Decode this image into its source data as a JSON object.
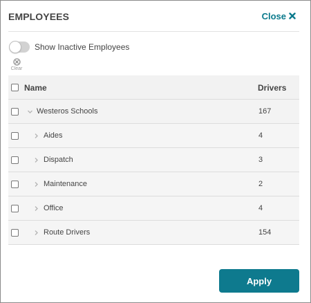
{
  "dialog": {
    "title": "EMPLOYEES",
    "close_label": "Close",
    "close_icon": "x-icon"
  },
  "filters": {
    "show_inactive_label": "Show Inactive Employees",
    "show_inactive_on": false,
    "clear_label": "Clear"
  },
  "grid": {
    "columns": {
      "name": "Name",
      "drivers": "Drivers"
    },
    "rows": [
      {
        "name": "Westeros Schools",
        "drivers": "167",
        "level": 0,
        "expanded": true
      },
      {
        "name": "Aides",
        "drivers": "4",
        "level": 1,
        "expanded": false
      },
      {
        "name": "Dispatch",
        "drivers": "3",
        "level": 1,
        "expanded": false
      },
      {
        "name": "Maintenance",
        "drivers": "2",
        "level": 1,
        "expanded": false
      },
      {
        "name": "Office",
        "drivers": "4",
        "level": 1,
        "expanded": false
      },
      {
        "name": "Route Drivers",
        "drivers": "154",
        "level": 1,
        "expanded": false
      }
    ]
  },
  "footer": {
    "apply_label": "Apply"
  },
  "colors": {
    "accent": "#0e7a8e",
    "link": "#0a7a8c"
  }
}
